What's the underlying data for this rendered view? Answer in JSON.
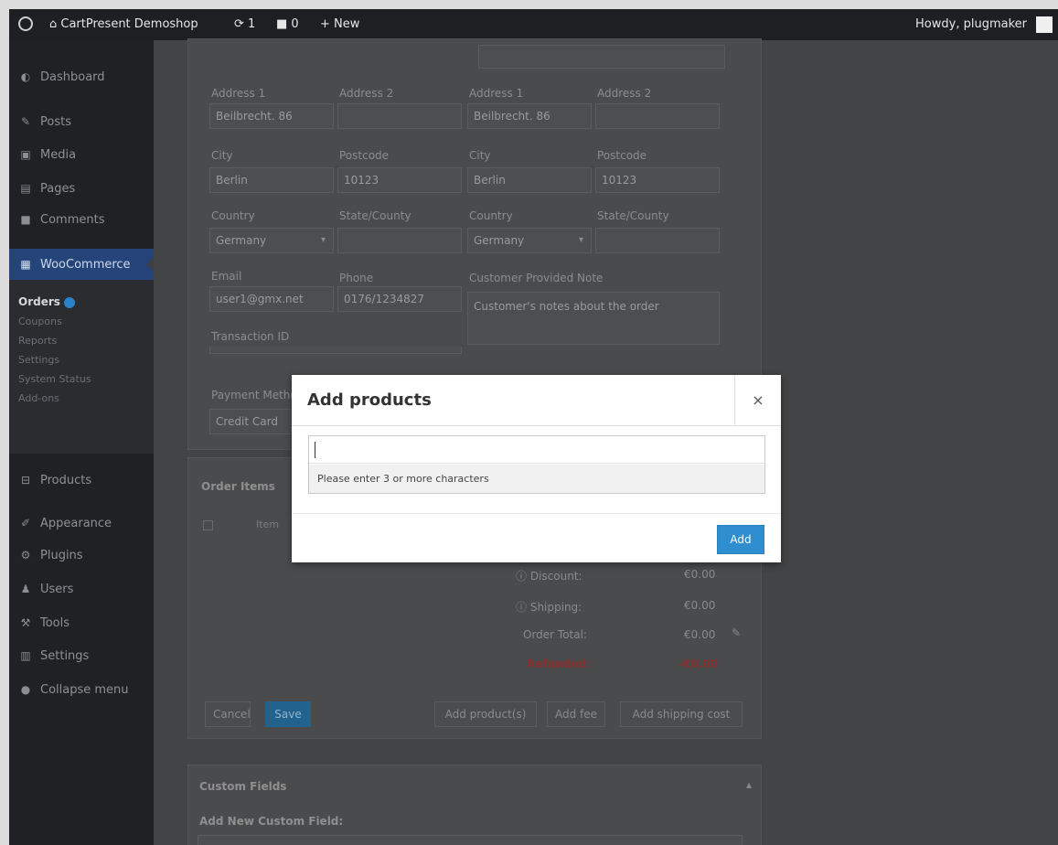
{
  "adminbar": {
    "site_name": "CartPresent Demoshop",
    "updates_count": "1",
    "comments_count": "0",
    "new_label": "New",
    "howdy": "Howdy, plugmaker"
  },
  "sidebar": {
    "items": [
      {
        "label": "Dashboard",
        "icon": "dashboard-icon"
      },
      {
        "label": "Posts",
        "icon": "pin-icon"
      },
      {
        "label": "Media",
        "icon": "media-icon"
      },
      {
        "label": "Pages",
        "icon": "pages-icon"
      },
      {
        "label": "Comments",
        "icon": "comments-icon"
      },
      {
        "label": "WooCommerce",
        "icon": "woocommerce-icon"
      },
      {
        "label": "Products",
        "icon": "products-icon"
      },
      {
        "label": "Appearance",
        "icon": "appearance-icon"
      },
      {
        "label": "Plugins",
        "icon": "plugins-icon"
      },
      {
        "label": "Users",
        "icon": "users-icon"
      },
      {
        "label": "Tools",
        "icon": "tools-icon"
      },
      {
        "label": "Settings",
        "icon": "settings-icon"
      },
      {
        "label": "Collapse menu",
        "icon": "collapse-icon"
      }
    ],
    "submenu": [
      "Orders",
      "Coupons",
      "Reports",
      "Settings",
      "System Status",
      "Add-ons"
    ]
  },
  "billing": {
    "address1_label": "Address 1",
    "address1_value": "Beilbrecht. 86",
    "address2_label": "Address 2",
    "address2_value": "",
    "city_label": "City",
    "city_value": "Berlin",
    "postcode_label": "Postcode",
    "postcode_value": "10123",
    "country_label": "Country",
    "country_value": "Germany",
    "state_label": "State/County",
    "state_value": "",
    "email_label": "Email",
    "email_value": "user1@gmx.net",
    "phone_label": "Phone",
    "phone_value": "0176/1234827",
    "transaction_label": "Transaction ID",
    "payment_label": "Payment Method",
    "payment_value": "Credit Card"
  },
  "shipping": {
    "address1_label": "Address 1",
    "address1_value": "Beilbrecht. 86",
    "address2_label": "Address 2",
    "address2_value": "",
    "city_label": "City",
    "city_value": "Berlin",
    "postcode_label": "Postcode",
    "postcode_value": "10123",
    "country_label": "Country",
    "country_value": "Germany",
    "state_label": "State/County",
    "state_value": "",
    "note_label": "Customer Provided Note",
    "note_placeholder": "Customer's notes about the order"
  },
  "order_items": {
    "title": "Order Items",
    "item_header": "Item",
    "totals": [
      {
        "label": "Discount:",
        "value": "€0.00"
      },
      {
        "label": "Shipping:",
        "value": "€0.00"
      },
      {
        "label": "Order Total:",
        "value": "€0.00"
      },
      {
        "label": "Refunded:",
        "value": "-€0.00"
      }
    ],
    "cancel_label": "Cancel",
    "save_label": "Save",
    "add_products_label": "Add product(s)",
    "add_fee_label": "Add fee",
    "add_shipping_label": "Add shipping cost"
  },
  "custom_fields": {
    "title": "Custom Fields",
    "add_new_label": "Add New Custom Field:"
  },
  "modal": {
    "title": "Add products",
    "close_symbol": "×",
    "search_placeholder": "",
    "hint": "Please enter 3 or more characters",
    "add_label": "Add"
  }
}
